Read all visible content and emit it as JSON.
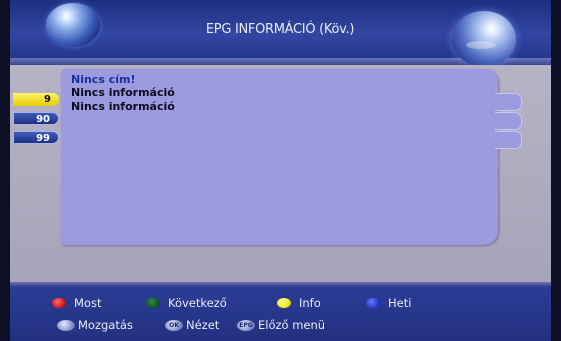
{
  "header": {
    "title": "EPG INFORMÁCIÓ (Köv.)"
  },
  "program": {
    "title": "Nincs cím!",
    "lines": [
      "Nincs információ",
      "Nincs információ"
    ]
  },
  "channels": [
    "9",
    "90",
    "99"
  ],
  "legend": {
    "color_keys": [
      {
        "color": "#d81c1c",
        "label": "Most"
      },
      {
        "color": "#0f5a22",
        "label": "Következő"
      },
      {
        "color": "#f2ea1a",
        "label": "Info"
      },
      {
        "color": "#2a3dd4",
        "label": "Heti"
      }
    ],
    "nav_keys": [
      {
        "icon": "arrow-pad-icon",
        "label": "Mozgatás"
      },
      {
        "icon": "ok-key-icon",
        "key_text": "OK",
        "label": "Nézet"
      },
      {
        "icon": "epg-key-icon",
        "key_text": "EPG",
        "label": "Előző menü"
      }
    ]
  }
}
